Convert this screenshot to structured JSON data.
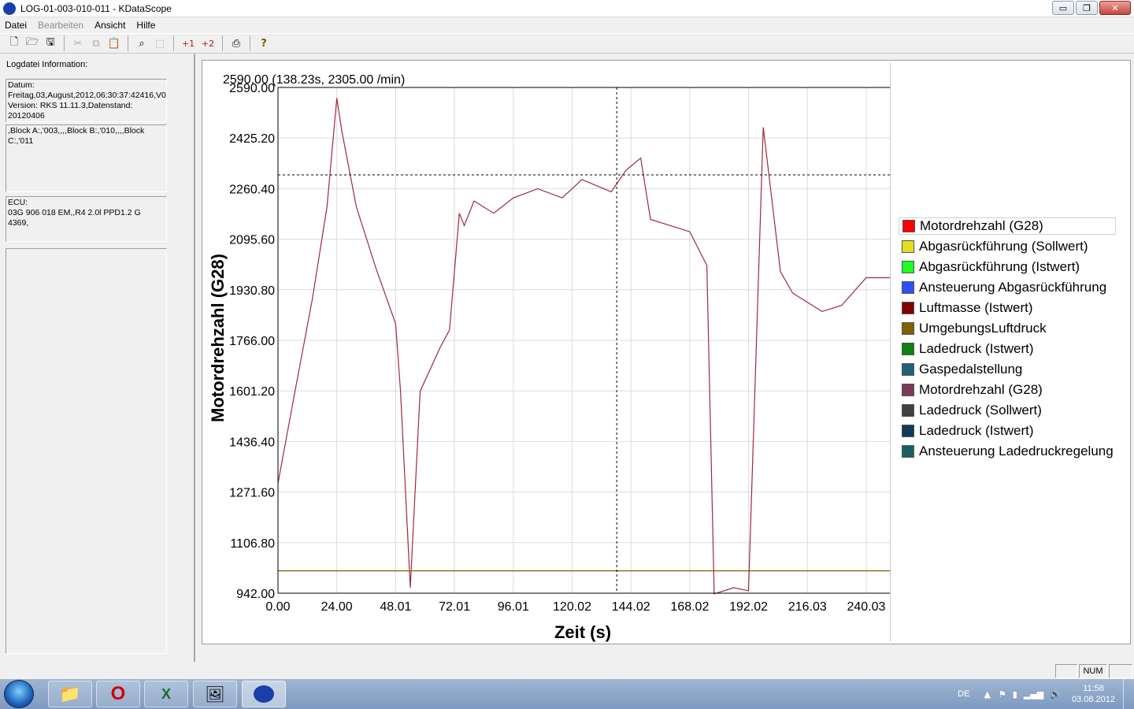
{
  "window": {
    "title": "LOG-01-003-010-011 - KDataScope",
    "buttons": {
      "minimize": "▭",
      "maximize": "❐",
      "close": "✕"
    }
  },
  "menu": {
    "datei": "Datei",
    "bearbeiten": "Bearbeiten",
    "ansicht": "Ansicht",
    "hilfe": "Hilfe"
  },
  "toolbar": {
    "plus1": "+1",
    "plus2": "+2",
    "help": "?"
  },
  "info": {
    "title": "Logdatei Information:",
    "datum": "Datum:\nFreitag,03,August,2012,06:30:37:42416,V0\nVersion: RKS 11.11.3,Datenstand:\n20120406",
    "blocks": ",Block A:,'003,,,,Block B:,'010,,,,Block\nC:,'011",
    "ecu": "ECU:\n03G 906 018 EM,,R4 2.0l PPD1.2 G\n4369,"
  },
  "chart_data": {
    "type": "line",
    "readout": "2590.00 (138.23s, 2305.00 /min)",
    "xlabel": "Zeit (s)",
    "ylabel": "Motordrehzahl (G28)",
    "xlim": [
      0,
      250
    ],
    "ylim": [
      942,
      2590
    ],
    "xticks": [
      "0.00",
      "24.00",
      "48.01",
      "72.01",
      "96.01",
      "120.02",
      "144.02",
      "168.02",
      "192.02",
      "216.03",
      "240.03"
    ],
    "yticks": [
      "2590.00",
      "2425.20",
      "2260.40",
      "2095.60",
      "1930.80",
      "1766.00",
      "1601.20",
      "1436.40",
      "1271.60",
      "1106.80",
      "942.00"
    ],
    "cursor": {
      "x": 138.23,
      "y": 2305.0
    },
    "grid": true,
    "series": [
      {
        "name": "Motordrehzahl (G28)",
        "color": "#a0283a",
        "x": [
          0,
          6,
          14,
          20,
          24,
          26,
          32,
          40,
          48,
          50,
          54,
          58,
          66,
          70,
          74,
          76,
          80,
          88,
          96,
          106,
          116,
          124,
          136,
          142,
          148,
          152,
          156,
          168,
          175,
          178,
          186,
          192,
          198,
          205,
          210,
          222,
          230,
          240,
          250
        ],
        "y": [
          1300,
          1560,
          1900,
          2200,
          2555,
          2450,
          2200,
          2000,
          1820,
          1600,
          960,
          1600,
          1740,
          1800,
          2180,
          2140,
          2220,
          2180,
          2230,
          2260,
          2230,
          2290,
          2250,
          2320,
          2360,
          2160,
          2150,
          2120,
          2010,
          940,
          960,
          950,
          2460,
          1990,
          1920,
          1860,
          1880,
          1970,
          1970
        ]
      },
      {
        "name": "Abgasrückführung (Sollwert)",
        "color": "#d8d000",
        "x": [],
        "y": []
      },
      {
        "name": "Abgasrückführung (Istwert)",
        "color": "#20e020",
        "x": [],
        "y": []
      },
      {
        "name": "Ansteuerung Abgasrückführung",
        "color": "#3050f0",
        "x": [],
        "y": []
      },
      {
        "name": "Luftmasse (Istwert)",
        "color": "#800000",
        "x": [],
        "y": []
      },
      {
        "name": "UmgebungsLuftdruck",
        "color": "#806000",
        "x": [
          0,
          250
        ],
        "y": [
          1015,
          1015
        ]
      },
      {
        "name": "Ladedruck (Istwert)",
        "color": "#108010",
        "x": [],
        "y": []
      },
      {
        "name": "Gaspedalstellung",
        "color": "#20607a",
        "x": [],
        "y": []
      },
      {
        "name": "Motordrehzahl (G28)",
        "color": "#7a3a5a",
        "x": [],
        "y": []
      },
      {
        "name": "Ladedruck (Sollwert)",
        "color": "#404040",
        "x": [],
        "y": []
      },
      {
        "name": "Ladedruck (Istwert)",
        "color": "#103a5a",
        "x": [],
        "y": []
      },
      {
        "name": "Ansteuerung Ladedruckregelung",
        "color": "#1a6060",
        "x": [],
        "y": []
      }
    ]
  },
  "legend": {
    "items": [
      "Motordrehzahl (G28)",
      "Abgasrückführung (Sollwert)",
      "Abgasrückführung (Istwert)",
      "Ansteuerung Abgasrückführung",
      "Luftmasse (Istwert)",
      "UmgebungsLuftdruck",
      "Ladedruck (Istwert)",
      "Gaspedalstellung",
      "Motordrehzahl (G28)",
      "Ladedruck (Sollwert)",
      "Ladedruck (Istwert)",
      "Ansteuerung Ladedruckregelung"
    ],
    "colors": [
      "#ff0000",
      "#e0e020",
      "#20ff20",
      "#3050ff",
      "#800000",
      "#806000",
      "#108010",
      "#20607a",
      "#7a3a5a",
      "#404040",
      "#103a5a",
      "#1a6060"
    ]
  },
  "statusbar": {
    "num": "NUM"
  },
  "taskbar": {
    "lang": "DE",
    "time": "11:58",
    "date": "03.08.2012"
  }
}
